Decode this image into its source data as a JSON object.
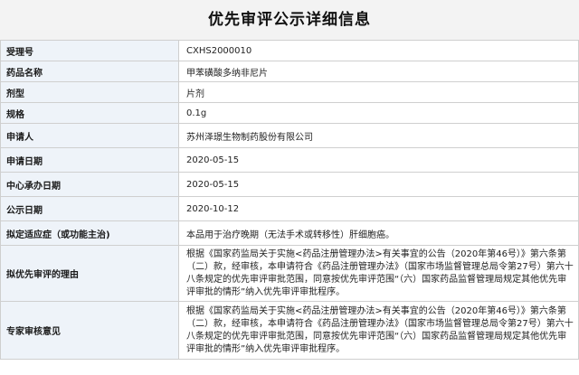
{
  "title": "优先审评公示详细信息",
  "rows": [
    {
      "label": "受理号",
      "value": "CXHS2000010"
    },
    {
      "label": "药品名称",
      "value": "甲苯磺酸多纳非尼片"
    },
    {
      "label": "剂型",
      "value": "片剂"
    },
    {
      "label": "规格",
      "value": "0.1g"
    },
    {
      "label": "申请人",
      "value": "苏州泽璟生物制药股份有限公司"
    },
    {
      "label": "申请日期",
      "value": "2020-05-15"
    },
    {
      "label": "中心承办日期",
      "value": "2020-05-15"
    },
    {
      "label": "公示日期",
      "value": "2020-10-12"
    },
    {
      "label": "拟定适应症（或功能主治)",
      "value": "本品用于治疗晚期（无法手术或转移性）肝细胞癌。"
    },
    {
      "label": "拟优先审评的理由",
      "value": "根据《国家药监局关于实施<药品注册管理办法>有关事宜的公告（2020年第46号）》第六条第（二）款，经审核，本申请符合《药品注册管理办法》（国家市场监督管理总局令第27号）第六十八条规定的优先审评审批范围，同意按优先审评范围“（六）国家药品监督管理局规定其他优先审评审批的情形”纳入优先审评审批程序。"
    },
    {
      "label": "专家审核意见",
      "value": "根据《国家药监局关于实施<药品注册管理办法>有关事宜的公告（2020年第46号）》第六条第（二）款，经审核，本申请符合《药品注册管理办法》（国家市场监督管理总局令第27号）第六十八条规定的优先审评审批范围，同意按优先审评范围“（六）国家药品监督管理局规定其他优先审评审批的情形”纳入优先审评审批程序。"
    }
  ]
}
